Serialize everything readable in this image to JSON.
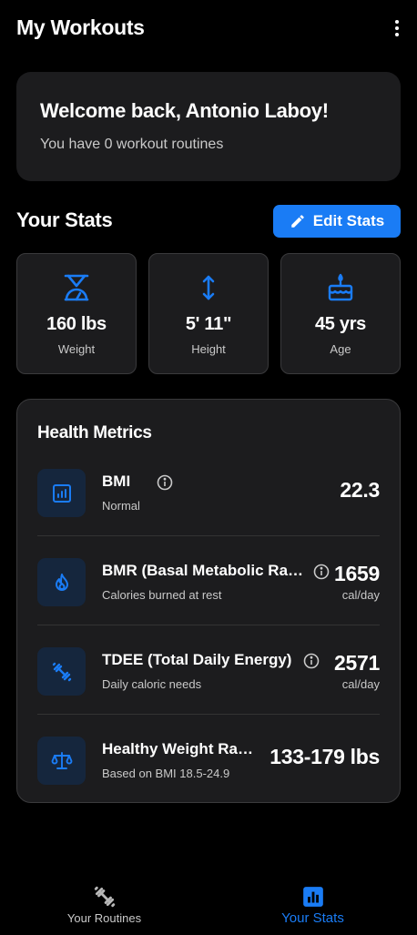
{
  "app": {
    "title": "My Workouts",
    "menu_icon": "more-vert-icon"
  },
  "welcome": {
    "title": "Welcome back, Antonio Laboy!",
    "subtitle": "You have 0 workout routines"
  },
  "stats_section": {
    "heading": "Your Stats",
    "edit_button": {
      "label": "Edit Stats",
      "icon": "pencil-icon"
    },
    "cards": [
      {
        "icon": "hourglass-scale-icon",
        "value": "160 lbs",
        "label": "Weight"
      },
      {
        "icon": "vertical-arrows-icon",
        "value": "5' 11\"",
        "label": "Height"
      },
      {
        "icon": "birthday-cake-icon",
        "value": "45 yrs",
        "label": "Age"
      }
    ]
  },
  "health_metrics": {
    "title": "Health Metrics",
    "items": [
      {
        "icon": "bar-chart-icon",
        "name": "BMI",
        "description": "Normal",
        "value": "22.3",
        "unit": "",
        "has_info": true
      },
      {
        "icon": "flame-icon",
        "name": "BMR (Basal Metabolic Rate)",
        "description": "Calories burned at rest",
        "value": "1659",
        "unit": "cal/day",
        "has_info": true
      },
      {
        "icon": "dumbbell-icon",
        "name": "TDEE (Total Daily Energy)",
        "description": "Daily caloric needs",
        "value": "2571",
        "unit": "cal/day",
        "has_info": true
      },
      {
        "icon": "balance-scale-icon",
        "name": "Healthy Weight Range",
        "description": "Based on BMI 18.5-24.9",
        "value": "133-179 lbs",
        "unit": "",
        "has_info": false
      }
    ]
  },
  "bottom_nav": {
    "items": [
      {
        "label": "Your Routines",
        "icon": "dumbbell-icon",
        "active": false
      },
      {
        "label": "Your Stats",
        "icon": "bar-chart-icon",
        "active": true
      }
    ]
  },
  "colors": {
    "accent": "#1a7cf5",
    "card_bg": "#1c1c1e",
    "icon_tile_bg": "#15263d",
    "background": "#000000"
  }
}
